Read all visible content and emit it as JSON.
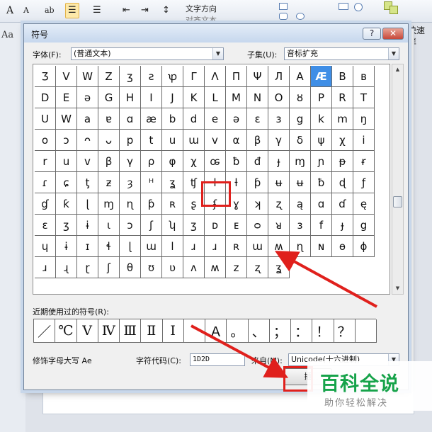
{
  "background": {
    "ribbon_text": "文字方向",
    "ribbon_text2": "对齐文本",
    "right_label": "快速样",
    "left_label": "Aa",
    "font_btn": "A",
    "font_btn_small": "A",
    "format_btn": "ab",
    "list_btn": "☰",
    "list_btn2": "☰",
    "indent_btn": "⇤",
    "indent_btn2": "⇥",
    "spacing_btn": "↕"
  },
  "dialog": {
    "title": "符号",
    "help_label": "?",
    "close_label": "✕",
    "font_label": "字体(F):",
    "font_value": "(普通文本)",
    "subset_label": "子集(U):",
    "subset_value": "音标扩充",
    "recent_label": "近期使用过的符号(R):",
    "char_name_label": "修饰字母大写 Ae",
    "code_label": "字符代码(C):",
    "code_value": "1D2D",
    "from_label": "来自(M):",
    "from_value": "Unicode(十六进制)",
    "ok_label": "插"
  },
  "symbols": [
    [
      "Ʒ",
      "V",
      "W",
      "Z",
      "ʒ",
      "ƨ",
      "ꝕ",
      "Γ",
      "Λ",
      "Π",
      "Ψ",
      "Л",
      "A",
      "Æ",
      "B"
    ],
    [
      "ʙ",
      "D",
      "E",
      "ǝ",
      "G",
      "H",
      "I",
      "J",
      "K",
      "L",
      "M",
      "N",
      "O",
      "ȣ",
      "P"
    ],
    [
      "R",
      "T",
      "U",
      "W",
      "a",
      "ɐ",
      "ɑ",
      "æ",
      "b",
      "d",
      "e",
      "ə",
      "ɛ",
      "ɜ",
      "g"
    ],
    [
      "k",
      "m",
      "ŋ",
      "o",
      "ɔ",
      "ᴖ",
      "ᴗ",
      "p",
      "t",
      "u",
      "ɯ",
      "v",
      "α",
      "β",
      "γ"
    ],
    [
      "δ",
      "ψ",
      "χ",
      "i",
      "r",
      "u",
      "v",
      "β",
      "γ",
      "ρ",
      "φ",
      "χ",
      "ꭀ",
      "ƀ",
      "đ",
      "ɟ"
    ],
    [
      "ɱ",
      "ɲ",
      "ᵽ",
      "ɍ",
      "ɾ",
      "ɕ",
      "ƫ",
      "ƶ",
      "ȝ",
      "ᴴ",
      "ʓ",
      "ʧ",
      "ɫ",
      "ƚ",
      "ƥ",
      "ʉ"
    ],
    [
      "ʉ",
      "ƀ",
      "ɖ",
      "ƒ",
      "ɠ",
      "ƙ",
      "ɭ",
      "ɱ",
      "ɳ",
      "ƥ",
      "ʀ",
      "ʂ",
      "ʄ",
      "ɣ",
      "ʞ",
      "ʐ"
    ],
    [
      "ą",
      "ɑ",
      "ɗ",
      "ę",
      "ɛ",
      "ʒ",
      "ɨ",
      "ɩ",
      "ɔ",
      "ʃ",
      "ʮ",
      "ʒ",
      "ᴅ",
      "ᴇ",
      "ᴑ",
      "ᴚ"
    ],
    [
      "ɜ",
      "f",
      "ɟ",
      "g",
      "ɥ",
      "ɨ",
      "ɪ",
      "ɬ",
      "ɭ",
      "ɯ",
      "l",
      "ɹ",
      "ɹ",
      "ʀ",
      "ɯ",
      "ʍ"
    ],
    [
      "ɳ",
      "ɴ",
      "ɵ",
      "ɸ",
      "ɹ",
      "ɻ",
      "ɽ",
      "ʃ",
      "θ",
      "ʊ",
      "ʋ",
      "ʌ",
      "ʍ",
      "z",
      "ʐ",
      "ʓ"
    ]
  ],
  "selected_symbol": "Æ",
  "recent_symbols": [
    "／",
    "℃",
    "Ⅴ",
    "Ⅳ",
    "Ⅲ",
    "Ⅱ",
    "Ⅰ",
    "",
    "Ａ",
    "。",
    "、",
    "；",
    "：",
    "！",
    "？",
    ""
  ],
  "watermark": {
    "main": "百科全说",
    "sub": "助你轻松解决"
  }
}
